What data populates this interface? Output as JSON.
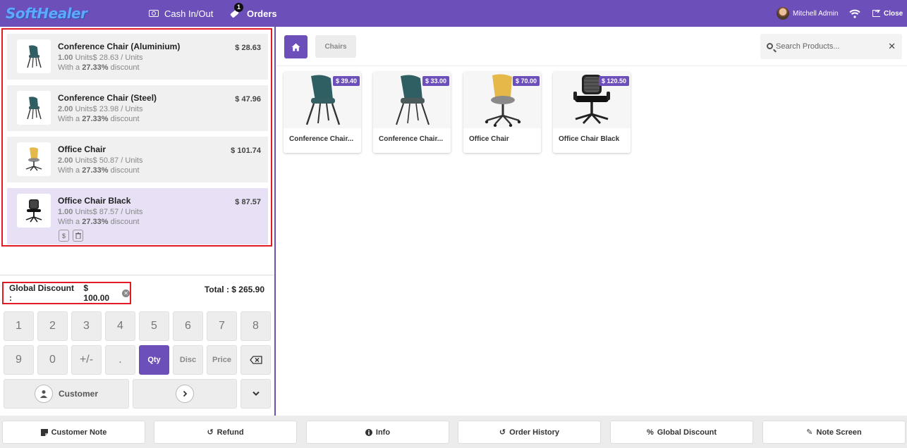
{
  "header": {
    "logo": "SoftHealer",
    "cash_label": "Cash In/Out",
    "orders_label": "Orders",
    "orders_badge": "1",
    "user_name": "Mitchell Admin",
    "close_label": "Close"
  },
  "orderlines": [
    {
      "name": "Conference Chair (Aluminium)",
      "price": "$ 28.63",
      "qty": "1.00",
      "unit_info": " Units$ 28.63 / Units",
      "disc_prefix": "With a ",
      "disc_value": "27.33%",
      "disc_suffix": " discount"
    },
    {
      "name": "Conference Chair (Steel)",
      "price": "$ 47.96",
      "qty": "2.00",
      "unit_info": " Units$ 23.98 / Units",
      "disc_prefix": "With a ",
      "disc_value": "27.33%",
      "disc_suffix": " discount"
    },
    {
      "name": "Office Chair",
      "price": "$ 101.74",
      "qty": "2.00",
      "unit_info": " Units$ 50.87 / Units",
      "disc_prefix": "With a ",
      "disc_value": "27.33%",
      "disc_suffix": " discount"
    },
    {
      "name": "Office Chair Black",
      "price": "$ 87.57",
      "qty": "1.00",
      "unit_info": " Units$ 87.57 / Units",
      "disc_prefix": "With a ",
      "disc_value": "27.33%",
      "disc_suffix": " discount",
      "price_btn": "$"
    }
  ],
  "summary": {
    "global_discount_label": "Global Discount :",
    "global_discount_value": "$ 100.00",
    "total": "Total : $ 265.90"
  },
  "numpad": {
    "row1": [
      "1",
      "2",
      "3",
      "4",
      "5",
      "6",
      "7",
      "8"
    ],
    "row2": [
      "9",
      "0",
      "+/-",
      ".",
      "Qty",
      "Disc",
      "Price"
    ],
    "customer_label": "Customer"
  },
  "categories": {
    "current": "Chairs"
  },
  "search": {
    "placeholder": "Search Products..."
  },
  "products": [
    {
      "name": "Conference Chair...",
      "price": "$ 39.40"
    },
    {
      "name": "Conference Chair...",
      "price": "$ 33.00"
    },
    {
      "name": "Office Chair",
      "price": "$ 70.00"
    },
    {
      "name": "Office Chair Black",
      "price": "$ 120.50"
    }
  ],
  "controls": [
    {
      "label": "Customer Note",
      "icon": "note-icon"
    },
    {
      "label": "Refund",
      "icon": "undo-icon"
    },
    {
      "label": "Info",
      "icon": "info-icon"
    },
    {
      "label": "Order History",
      "icon": "history-icon"
    },
    {
      "label": "Global Discount",
      "icon": "percent-icon"
    },
    {
      "label": "Note Screen",
      "icon": "edit-icon"
    }
  ],
  "colors": {
    "brand": "#6c4fb8",
    "highlight": "#e01b24",
    "selected_line": "#e8e0f5"
  }
}
